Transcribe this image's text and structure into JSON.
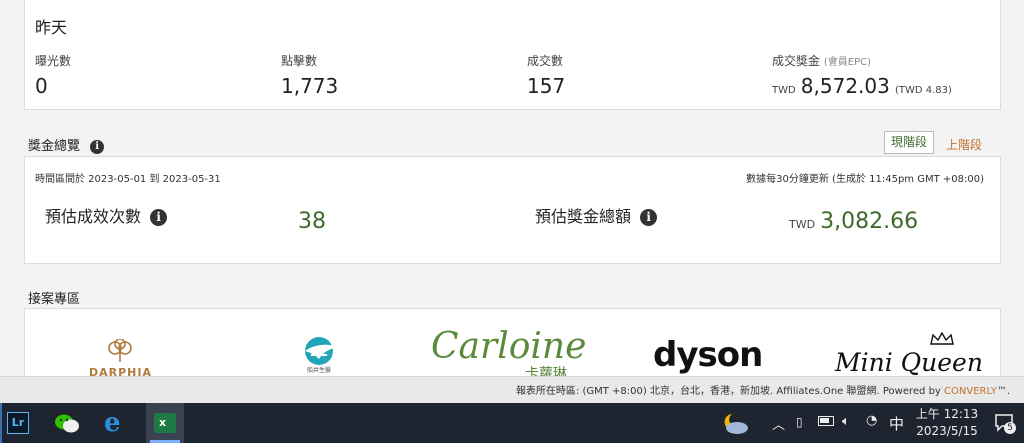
{
  "yesterday": {
    "title": "昨天",
    "stats": [
      {
        "label": "曝光數",
        "value": "0"
      },
      {
        "label": "點擊數",
        "value": "1,773"
      },
      {
        "label": "成交數",
        "value": "157"
      }
    ],
    "bonus": {
      "label": "成交獎金",
      "sublabel": "(會員EPC)",
      "currency": "TWD",
      "value": "8,572.03",
      "epc": "(TWD  4.83)"
    }
  },
  "overview": {
    "title": "獎金總覽",
    "tabs": {
      "current": "現階段",
      "previous": "上階段"
    },
    "period": "時間區間於 2023-05-01 到 2023-05-31",
    "update_note": "數據每30分鐘更新 (生成於 11:45pm GMT +08:00)",
    "est_count_label": "預估成效次數",
    "est_count_value": "38",
    "est_bonus_label": "預估獎金總額",
    "est_bonus_currency": "TWD",
    "est_bonus_value": "3,082.66"
  },
  "cases": {
    "title": "接案專區",
    "brands": [
      "DARPHIA",
      "Carloine",
      "卡蘿琳",
      "dyson",
      "Mini Queen"
    ]
  },
  "footer": {
    "prefix": "報表所在時區: (GMT +8:00) 北京，台北，香港，新加坡. Affiliates.One 聯盟網. Powered by ",
    "brand": "CONVERLY",
    "suffix": "™."
  },
  "taskbar": {
    "apps": [
      "Lr",
      "WeChat",
      "Internet Explorer",
      "Excel"
    ],
    "ime": "中",
    "time": "上午 12:13",
    "date": "2023/5/15",
    "notification_count": "5"
  },
  "colors": {
    "accent_green": "#3d6b2c",
    "link_orange": "#c0722c"
  }
}
